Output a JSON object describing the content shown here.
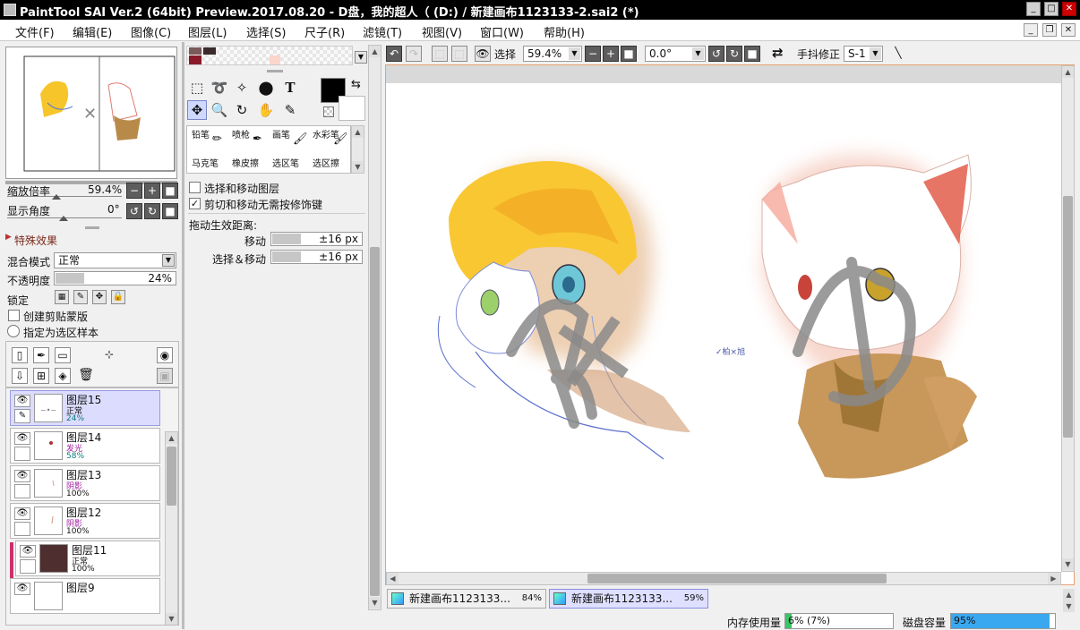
{
  "window": {
    "title": "PaintTool SAI Ver.2 (64bit) Preview.2017.08.20 - D盘，我的超人（ (D:) / 新建画布1123133-2.sai2 (*)"
  },
  "menu": [
    "文件(F)",
    "编辑(E)",
    "图像(C)",
    "图层(L)",
    "选择(S)",
    "尺子(R)",
    "滤镜(T)",
    "视图(V)",
    "窗口(W)",
    "帮助(H)"
  ],
  "navigator": {
    "zoom_label": "缩放倍率",
    "zoom_value": "59.4%",
    "angle_label": "显示角度",
    "angle_value": "0°"
  },
  "layer_props": {
    "effects_label": "特殊效果",
    "blend_label": "混合模式",
    "blend_value": "正常",
    "opacity_label": "不透明度",
    "opacity_value": "24%",
    "lock_label": "锁定",
    "clip_label": "创建剪贴蒙版",
    "selsrc_label": "指定为选区样本"
  },
  "layers": [
    {
      "name": "图层15",
      "mode": "正常",
      "opacity": "24%"
    },
    {
      "name": "图层14",
      "mode": "发光",
      "opacity": "58%"
    },
    {
      "name": "图层13",
      "mode": "阴影",
      "opacity": "100%"
    },
    {
      "name": "图层12",
      "mode": "阴影",
      "opacity": "100%"
    },
    {
      "name": "图层11",
      "mode": "正常",
      "opacity": "100%"
    },
    {
      "name": "图层9"
    }
  ],
  "brushes": [
    {
      "label": "铅笔"
    },
    {
      "label": "喷枪"
    },
    {
      "label": "画笔"
    },
    {
      "label": "水彩笔"
    },
    {
      "label": "马克笔"
    },
    {
      "label": "橡皮擦"
    },
    {
      "label": "选区笔"
    },
    {
      "label": "选区擦"
    }
  ],
  "tool_options": {
    "select_move_layer": "选择和移动图层",
    "cut_move": "剪切和移动无需按修饰键",
    "drag_label": "拖动生效距离:",
    "move_label": "移动",
    "move_value": "±16 px",
    "selmove_label": "选择＆移动",
    "selmove_value": "±16 px"
  },
  "toolbar": {
    "select_label": "选择",
    "zoom_value": "59.4%",
    "angle_value": "0.0°",
    "stabilizer_label": "手抖修正",
    "stabilizer_value": "S-1"
  },
  "canvas": {
    "watermark": "柏 × 旭",
    "signature": "✓柏×旭"
  },
  "doc_tabs": [
    {
      "name": "新建画布1123133...",
      "zoom": "84%"
    },
    {
      "name": "新建画布1123133...",
      "zoom": "59%"
    }
  ],
  "status": {
    "memory_label": "内存使用量",
    "memory_value": "6% (7%)",
    "memory_fraction": 0.06,
    "disk_label": "磁盘容量",
    "disk_value": "95%",
    "disk_fraction": 0.95
  }
}
